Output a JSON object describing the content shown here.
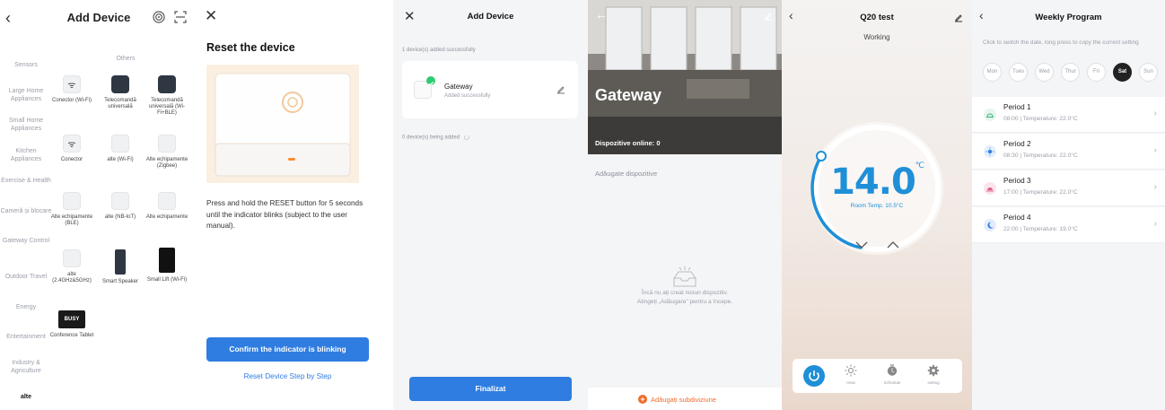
{
  "panel1": {
    "title": "Add Device",
    "categories": [
      "Sensors",
      "Large Home Appliances",
      "Small Home Appliances",
      "Kitchen Appliances",
      "Exercise & Health",
      "Cameră și blocare",
      "Gateway Control",
      "Outdoor Travel",
      "Energy",
      "Entertainment",
      "Industry & Agriculture",
      "alte"
    ],
    "active_category": "alte",
    "section_label": "Others",
    "devices": [
      {
        "label": "Conector (Wi-Fi)",
        "icon": "wifi-icon"
      },
      {
        "label": "Telecomandă universală",
        "icon": "remote-icon"
      },
      {
        "label": "Telecomandă universală (Wi-Fi+BLE)",
        "icon": "remote-icon"
      },
      {
        "label": "Conector",
        "icon": "wifi-icon"
      },
      {
        "label": "alte (Wi-Fi)",
        "icon": "device-icon"
      },
      {
        "label": "Alte echipamente (Zigbee)",
        "icon": "device-icon"
      },
      {
        "label": "Alte echipamente (BLE)",
        "icon": "device-icon"
      },
      {
        "label": "alte (NB-IoT)",
        "icon": "device-icon"
      },
      {
        "label": "Alte echipamente",
        "icon": "device-icon"
      },
      {
        "label": "alte (2.4GHz&5GHz)",
        "icon": "device-icon"
      },
      {
        "label": "Smart Speaker",
        "icon": "speaker-icon"
      },
      {
        "label": "Small Lift (Wi-Fi)",
        "icon": "lift-icon"
      },
      {
        "label": "Conference Tablet",
        "icon": "tablet-icon",
        "badge": "BUSY"
      }
    ]
  },
  "panel2": {
    "title": "Reset the device",
    "description": "Press and hold the RESET button for 5 seconds until the indicator blinks (subject to the user manual).",
    "confirm_button": "Confirm the indicator is blinking",
    "step_link": "Reset Device Step by Step"
  },
  "panel3": {
    "title": "Add Device",
    "added_count_text": "1 device(s) added successfully",
    "device_name": "Gateway",
    "device_status": "Added successfully",
    "being_added_text": "0 device(s) being added",
    "finish_button": "Finalizat"
  },
  "panel4": {
    "gateway_name": "Gateway",
    "online_text": "Dispozitive online: 0",
    "section_label": "Adăugate dispozitive",
    "empty_line1": "Încă nu ați creat niciun dispozitiv.",
    "empty_line2": "Atingeți „Adăugare” pentru a începe.",
    "add_label": "Adăugați subdiviziune"
  },
  "panel5": {
    "title": "Q20 test",
    "status": "Working",
    "temperature": "14.0",
    "unit": "℃",
    "room_temp": "Room Temp. 10.5°C",
    "tools": [
      {
        "label": "Heat",
        "icon": "sun-icon"
      },
      {
        "label": "Schedule",
        "icon": "schedule-icon"
      },
      {
        "label": "setting",
        "icon": "gear-icon"
      }
    ],
    "accent": "#1f8fd8"
  },
  "panel6": {
    "title": "Weekly Program",
    "hint": "Click to switch the date, long press to copy the current setting",
    "days": [
      "Mon",
      "Tues",
      "Wed",
      "Thur",
      "Fri",
      "Sat",
      "Sun"
    ],
    "selected_day": "Sat",
    "periods": [
      {
        "name": "Period 1",
        "detail": "08:00 | Temperature: 22.0°C",
        "color": "#e6f6ee",
        "icon": "sunrise-icon"
      },
      {
        "name": "Period 2",
        "detail": "08:30 | Temperature: 22.0°C",
        "color": "#e4f0fb",
        "icon": "sun-icon"
      },
      {
        "name": "Period 3",
        "detail": "17:00 | Temperature: 22.0°C",
        "color": "#fbe4ee",
        "icon": "sunset-icon"
      },
      {
        "name": "Period 4",
        "detail": "22:00 | Temperature: 19.0°C",
        "color": "#e4ecfb",
        "icon": "moon-icon"
      }
    ]
  }
}
